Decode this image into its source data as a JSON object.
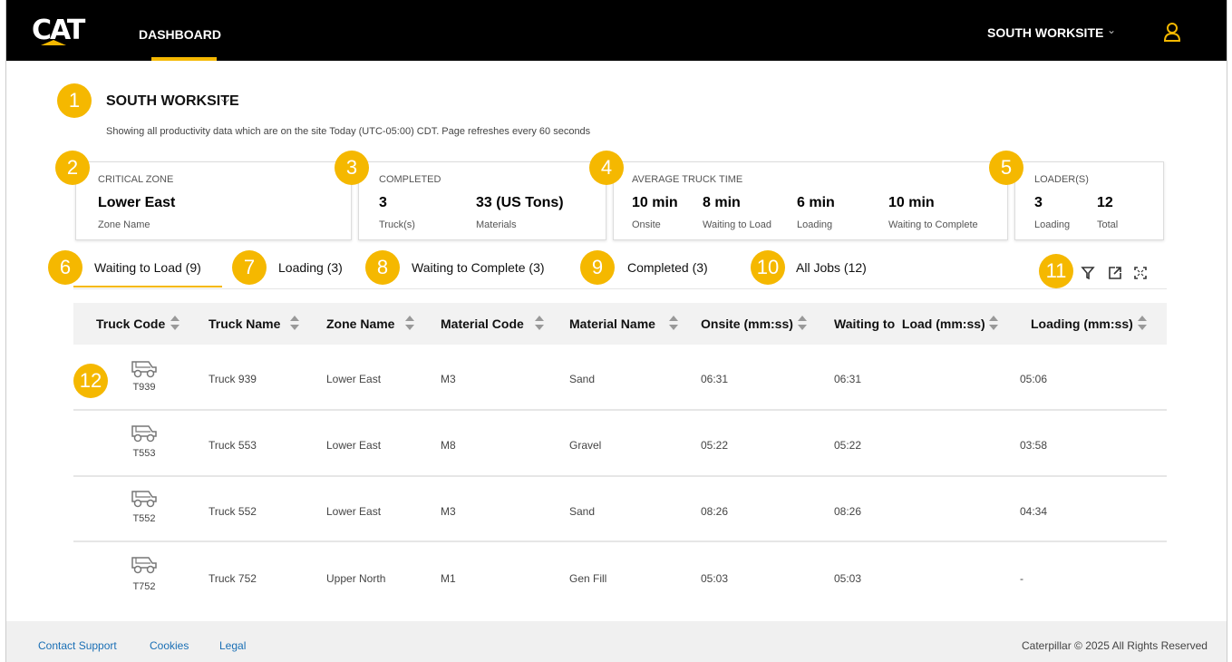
{
  "topbar": {
    "logo_text": "CAT",
    "nav_dashboard": "DASHBOARD",
    "site_selector": "SOUTH WORKSITE",
    "accent_color": "#f5b800"
  },
  "header": {
    "site_title": "SOUTH WORKSITE",
    "subtitle": "Showing all productivity data which are on the site Today (UTC-05:00) CDT. Page refreshes every 60 seconds"
  },
  "badges": [
    "1",
    "2",
    "3",
    "4",
    "5",
    "6",
    "7",
    "8",
    "9",
    "10",
    "11",
    "12"
  ],
  "cards": {
    "critical": {
      "label": "CRITICAL ZONE",
      "value": "Lower East",
      "sub": "Zone Name"
    },
    "completed": {
      "label": "COMPLETED",
      "v1": "3",
      "s1": "Truck(s)",
      "v2": "33 (US Tons)",
      "s2": "Materials"
    },
    "avg": {
      "label": "AVERAGE TRUCK TIME",
      "v1": "10 min",
      "s1": "Onsite",
      "v2": "8 min",
      "s2": "Waiting to Load",
      "v3": "6 min",
      "s3": "Loading",
      "v4": "10 min",
      "s4": "Waiting to Complete"
    },
    "loaders": {
      "label": "LOADER(S)",
      "v1": "3",
      "s1": "Loading",
      "v2": "12",
      "s2": "Total"
    }
  },
  "tabs": [
    "Waiting to Load (9)",
    "Loading (3)",
    "Waiting to Complete (3)",
    "Completed (3)",
    "All Jobs (12)"
  ],
  "toolbar_icons": [
    "filter-icon",
    "external-link-icon",
    "fullscreen-icon"
  ],
  "table": {
    "headers": [
      "Truck Code",
      "Truck Name",
      "Zone Name",
      "Material Code",
      "Material Name",
      "Onsite (mm:ss)",
      "Waiting to  Load (mm:ss)",
      "Loading (mm:ss)"
    ],
    "rows": [
      {
        "code": "T939",
        "name": "Truck 939",
        "zone": "Lower East",
        "mcode": "M3",
        "mname": "Sand",
        "onsite": "06:31",
        "waiting": "06:31",
        "loading": "05:06"
      },
      {
        "code": "T553",
        "name": "Truck 553",
        "zone": "Lower East",
        "mcode": "M8",
        "mname": "Gravel",
        "onsite": "05:22",
        "waiting": "05:22",
        "loading": "03:58"
      },
      {
        "code": "T552",
        "name": "Truck 552",
        "zone": "Lower East",
        "mcode": "M3",
        "mname": "Sand",
        "onsite": "08:26",
        "waiting": "08:26",
        "loading": "04:34"
      },
      {
        "code": "T752",
        "name": "Truck 752",
        "zone": "Upper North",
        "mcode": "M1",
        "mname": "Gen Fill",
        "onsite": "05:03",
        "waiting": "05:03",
        "loading": "-"
      }
    ]
  },
  "footer": {
    "contact": "Contact Support",
    "cookies": "Cookies",
    "legal": "Legal",
    "copyright": "Caterpillar © 2025 All Rights Reserved"
  }
}
